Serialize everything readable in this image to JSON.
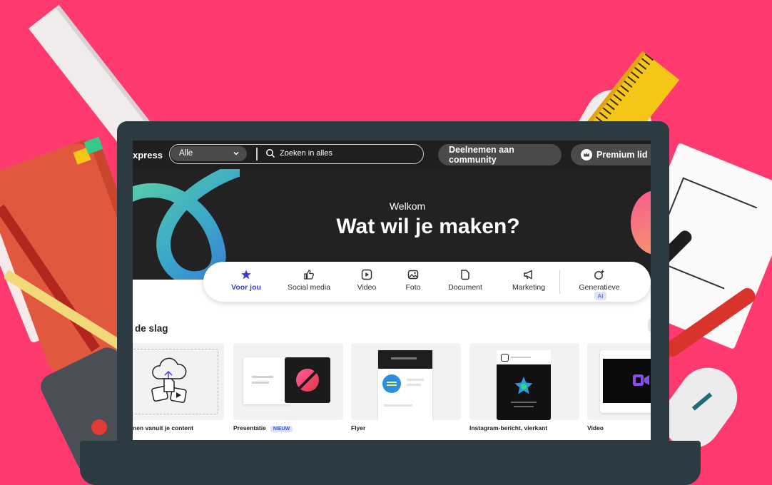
{
  "colors": {
    "background": "#ff3a6e",
    "accent": "#3d3bd1",
    "hero": "#222222"
  },
  "topbar": {
    "brand": "xpress",
    "filter_value": "Alle",
    "search_placeholder": "Zoeken in alles",
    "community_button": "Deelnemen aan community",
    "premium_button": "Premium lid"
  },
  "hero": {
    "welcome": "Welkom",
    "headline": "Wat wil je maken?"
  },
  "tabs": [
    {
      "label": "Voor jou",
      "icon": "star-icon",
      "active": true
    },
    {
      "label": "Social media",
      "icon": "thumbs-up-icon"
    },
    {
      "label": "Video",
      "icon": "play-icon"
    },
    {
      "label": "Foto",
      "icon": "image-icon"
    },
    {
      "label": "Document",
      "icon": "document-icon"
    },
    {
      "label": "Marketing",
      "icon": "megaphone-icon"
    },
    {
      "label": "Generatieve",
      "icon": "sparkle-image-icon",
      "badge": "AI"
    }
  ],
  "section": {
    "title": "de slag"
  },
  "cards": [
    {
      "label": "nen vanuit je content"
    },
    {
      "label": "Presentatie",
      "badge": "NIEUW"
    },
    {
      "label": "Flyer"
    },
    {
      "label": "Instagram-bericht, vierkant"
    },
    {
      "label": "Video"
    }
  ]
}
